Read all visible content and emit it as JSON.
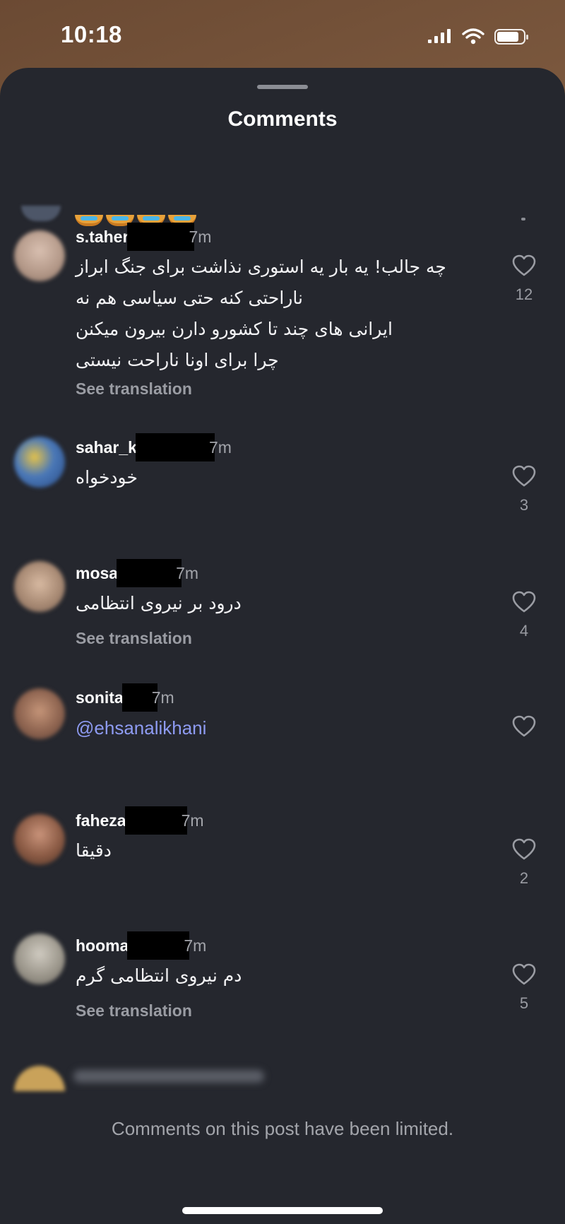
{
  "status_bar": {
    "time": "10:18"
  },
  "sheet": {
    "title": "Comments"
  },
  "comments": [
    {
      "username": "s.taher",
      "time": "7m",
      "lines": [
        "چه جالب! یه بار یه استوری نذاشت برای جنگ ابراز",
        "ناراحتی کنه حتی سیاسی هم نه",
        "ایرانی های چند تا کشورو دارن بیرون میکنن",
        "چرا برای اونا ناراحت نیستی"
      ],
      "see_translation": "See translation",
      "likes": "12"
    },
    {
      "username": "sahar_k",
      "time": "7m",
      "lines": [
        "خودخواه"
      ],
      "likes": "3"
    },
    {
      "username": "mosa",
      "time": "7m",
      "lines": [
        "درود بر نیروی انتظامی"
      ],
      "see_translation": "See translation",
      "likes": "4"
    },
    {
      "username": "sonita",
      "time": "7m",
      "mention": "@ehsanalikhani"
    },
    {
      "username": "faheza",
      "time": "7m",
      "lines": [
        "دقیقا"
      ],
      "likes": "2"
    },
    {
      "username": "hooma",
      "time": "7m",
      "lines": [
        "دم نیروی انتظامی گرم"
      ],
      "see_translation": "See translation",
      "likes": "5"
    }
  ],
  "footer": {
    "limited_note": "Comments on this post have been limited."
  },
  "colors": {
    "sheet_bg": "#25272e",
    "mention": "#8e9bf2",
    "muted": "#9a9ca3"
  }
}
